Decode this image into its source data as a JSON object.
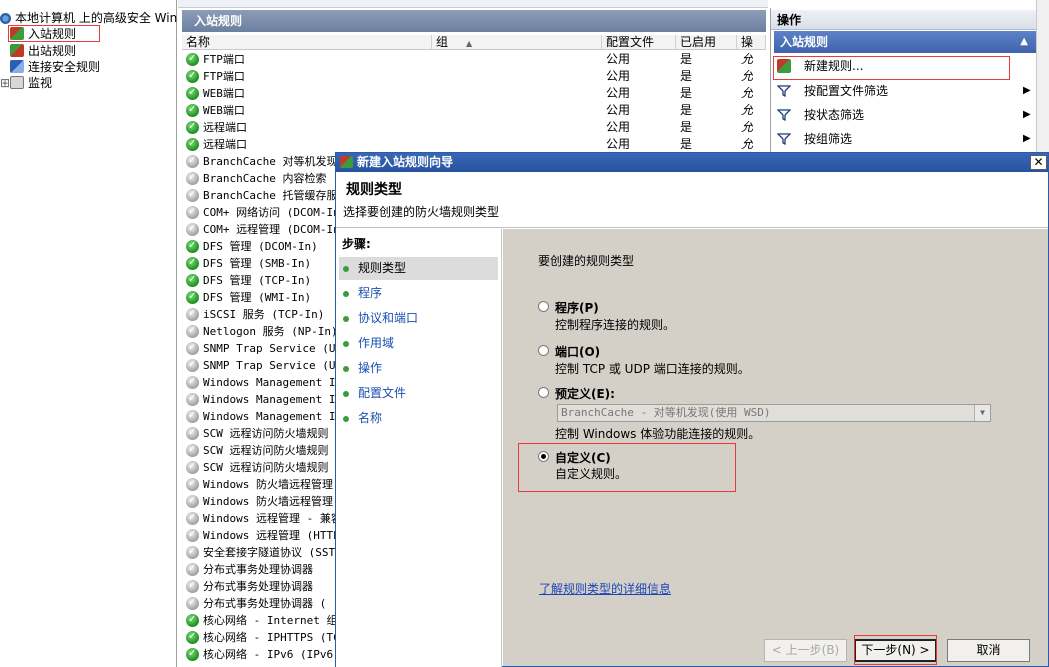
{
  "tree": {
    "root": "本地计算机 上的高级安全 Win",
    "items": [
      {
        "label": "入站规则",
        "icon": "firewall-inbound-icon"
      },
      {
        "label": "出站规则",
        "icon": "firewall-outbound-icon"
      },
      {
        "label": "连接安全规则",
        "icon": "connection-security-icon"
      },
      {
        "label": "监视",
        "icon": "monitor-icon"
      }
    ]
  },
  "list": {
    "title": "入站规则",
    "columns": {
      "name": "名称",
      "group": "组",
      "profile": "配置文件",
      "enabled": "已启用",
      "action": "操"
    },
    "rows": [
      {
        "name": "FTP端口",
        "profile": "公用",
        "enabled": "是",
        "action": "允",
        "on": true
      },
      {
        "name": "FTP端口",
        "profile": "公用",
        "enabled": "是",
        "action": "允",
        "on": true
      },
      {
        "name": "WEB端口",
        "profile": "公用",
        "enabled": "是",
        "action": "允",
        "on": true
      },
      {
        "name": "WEB端口",
        "profile": "公用",
        "enabled": "是",
        "action": "允",
        "on": true
      },
      {
        "name": "远程端口",
        "profile": "公用",
        "enabled": "是",
        "action": "允",
        "on": true
      },
      {
        "name": "远程端口",
        "profile": "公用",
        "enabled": "是",
        "action": "允",
        "on": true
      },
      {
        "name": "BranchCache 对等机发现",
        "on": false
      },
      {
        "name": "BranchCache 内容检索 (",
        "on": false
      },
      {
        "name": "BranchCache 托管缓存服",
        "on": false
      },
      {
        "name": "COM+ 网络访问 (DCOM-In)",
        "on": false
      },
      {
        "name": "COM+ 远程管理 (DCOM-In)",
        "on": false
      },
      {
        "name": "DFS 管理 (DCOM-In)",
        "on": true
      },
      {
        "name": "DFS 管理 (SMB-In)",
        "on": true
      },
      {
        "name": "DFS 管理 (TCP-In)",
        "on": true
      },
      {
        "name": "DFS 管理 (WMI-In)",
        "on": true
      },
      {
        "name": "iSCSI 服务 (TCP-In)",
        "on": false
      },
      {
        "name": "Netlogon 服务 (NP-In)",
        "on": false
      },
      {
        "name": "SNMP Trap Service (UDP",
        "on": false
      },
      {
        "name": "SNMP Trap Service (UDP",
        "on": false
      },
      {
        "name": "Windows Management Ins",
        "on": false
      },
      {
        "name": "Windows Management Ins",
        "on": false
      },
      {
        "name": "Windows Management Ins",
        "on": false
      },
      {
        "name": "SCW 远程访问防火墙规则",
        "on": false
      },
      {
        "name": "SCW 远程访问防火墙规则",
        "on": false
      },
      {
        "name": "SCW 远程访问防火墙规则",
        "on": false
      },
      {
        "name": "Windows 防火墙远程管理",
        "on": false
      },
      {
        "name": "Windows 防火墙远程管理",
        "on": false
      },
      {
        "name": "Windows 远程管理 - 兼容",
        "on": false
      },
      {
        "name": "Windows 远程管理 (HTTP-",
        "on": false
      },
      {
        "name": "安全套接字隧道协议 (SST",
        "on": false
      },
      {
        "name": "分布式事务处理协调器",
        "on": false
      },
      {
        "name": "分布式事务处理协调器",
        "on": false
      },
      {
        "name": "分布式事务处理协调器 (",
        "on": false
      },
      {
        "name": "核心网络 - Internet 组",
        "on": true
      },
      {
        "name": "核心网络 - IPHTTPS (TC",
        "on": true
      },
      {
        "name": "核心网络 - IPv6 (IPv6-",
        "on": true
      }
    ]
  },
  "actions": {
    "title": "操作",
    "section": "入站规则",
    "items": [
      {
        "label": "新建规则...",
        "icon": "new-rule-icon",
        "arrow": ""
      },
      {
        "label": "按配置文件筛选",
        "icon": "filter-icon",
        "arrow": "▶"
      },
      {
        "label": "按状态筛选",
        "icon": "filter-icon",
        "arrow": "▶"
      },
      {
        "label": "按组筛选",
        "icon": "filter-icon",
        "arrow": "▶"
      }
    ]
  },
  "dialog": {
    "title": "新建入站规则向导",
    "close": "✕",
    "heading": "规则类型",
    "subheading": "选择要创建的防火墙规则类型",
    "steps_title": "步骤:",
    "steps": [
      "规则类型",
      "程序",
      "协议和端口",
      "作用域",
      "操作",
      "配置文件",
      "名称"
    ],
    "prompt": "要创建的规则类型",
    "options": [
      {
        "label": "程序(P)",
        "desc": "控制程序连接的规则。",
        "checked": false
      },
      {
        "label": "端口(O)",
        "desc": "控制 TCP 或 UDP 端口连接的规则。",
        "checked": false
      },
      {
        "label": "预定义(E):",
        "desc": "控制 Windows 体验功能连接的规则。",
        "checked": false
      },
      {
        "label": "自定义(C)",
        "desc": "自定义规则。",
        "checked": true
      }
    ],
    "predefined_value": "BranchCache - 对等机发现(使用 WSD)",
    "learn_more": "了解规则类型的详细信息",
    "buttons": {
      "back": "< 上一步(B)",
      "next": "下一步(N) >",
      "cancel": "取消"
    }
  },
  "colors": {
    "accent": "#3f63ad",
    "highlight": "#e83a3a",
    "dialog_title": "#2752a0",
    "panel": "#d4d0c8"
  }
}
